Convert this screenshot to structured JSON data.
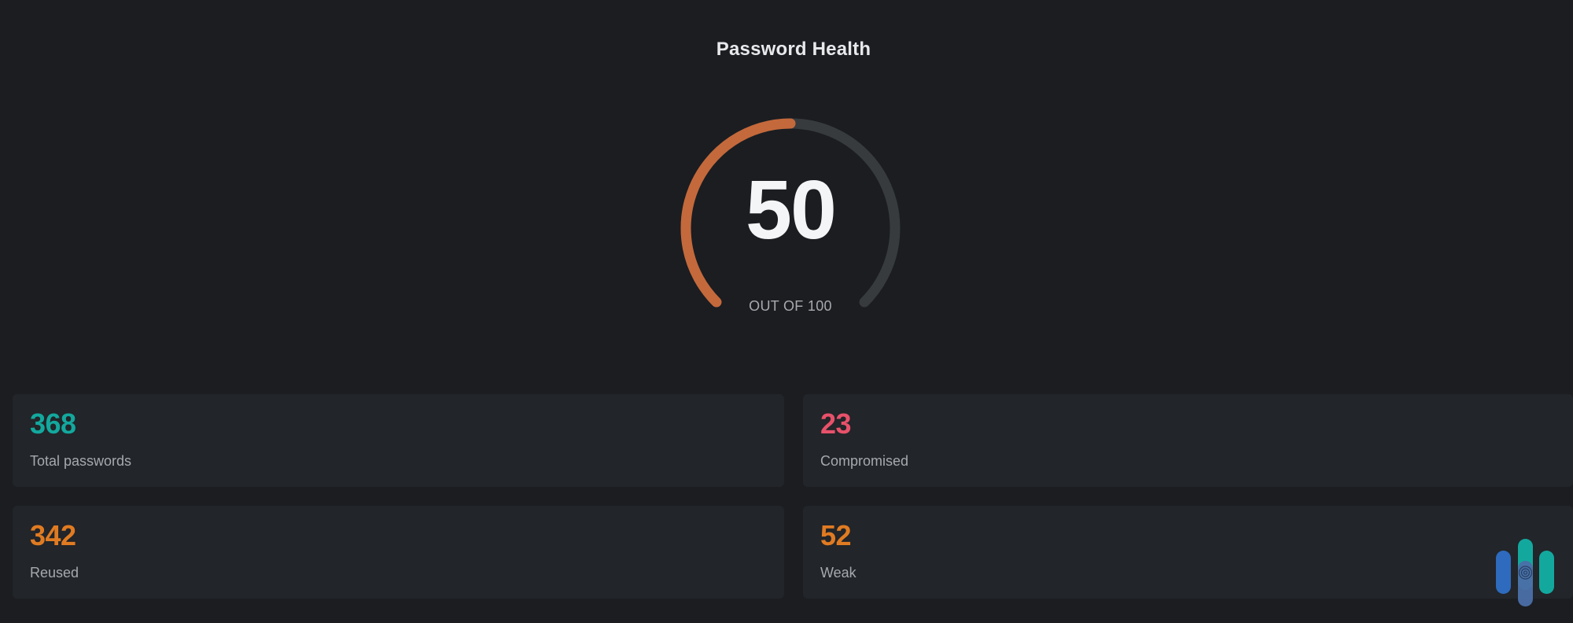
{
  "title": "Password Health",
  "score": {
    "value": "50",
    "out_of_label": "OUT OF 100",
    "fraction": 0.5,
    "colors": {
      "progress": "#c4693b",
      "track": "#383b3e"
    }
  },
  "stats": {
    "total": {
      "value": "368",
      "label": "Total passwords",
      "color": "#13a89e"
    },
    "compromised": {
      "value": "23",
      "label": "Compromised",
      "color": "#e8516a"
    },
    "reused": {
      "value": "342",
      "label": "Reused",
      "color": "#e07b22"
    },
    "weak": {
      "value": "52",
      "label": "Weak",
      "color": "#e07b22"
    }
  },
  "logo": {
    "icon": "brand-bars-logo-icon",
    "colors": [
      "#2e6bbf",
      "#13a89e",
      "#4b6fa8"
    ]
  }
}
